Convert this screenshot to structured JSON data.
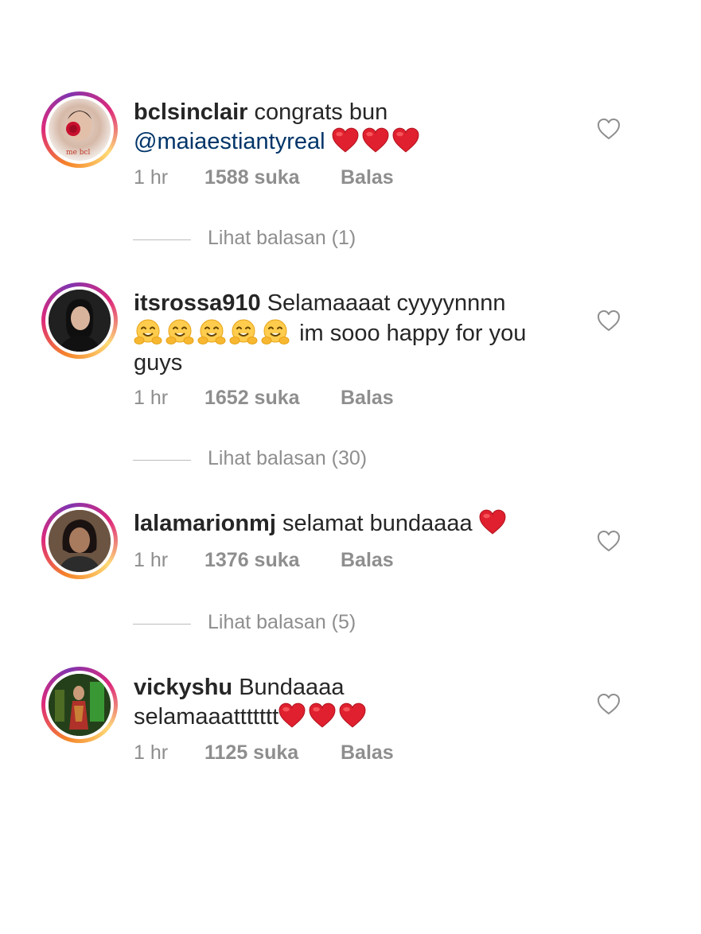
{
  "comments": [
    {
      "username": "bclsinclair",
      "text": "congrats bun",
      "mention": "@maiaestiantyreal",
      "time": "1 hr",
      "likes": "1588 suka",
      "reply": "Balas",
      "view_replies": "Lihat balasan (1)"
    },
    {
      "username": "itsrossa910",
      "text": "Selamaaaat cyyyynnnn",
      "text_after_emoji": "im sooo happy for you guys",
      "time": "1 hr",
      "likes": "1652 suka",
      "reply": "Balas",
      "view_replies": "Lihat balasan (30)"
    },
    {
      "username": "lalamarionmj",
      "text": "selamat bundaaaa",
      "time": "1 hr",
      "likes": "1376 suka",
      "reply": "Balas",
      "view_replies": "Lihat balasan (5)"
    },
    {
      "username": "vickyshu",
      "text": "Bundaaaa selamaaattttttt",
      "time": "1 hr",
      "likes": "1125 suka",
      "reply": "Balas"
    }
  ],
  "colors": {
    "text": "#262626",
    "secondary": "#8e8e8e",
    "mention": "#003569",
    "heart_emoji": "#e0202f",
    "ring_gradient": [
      "#f58529",
      "#dd2a7b",
      "#8134af",
      "#feda77"
    ]
  },
  "icons": {
    "like": "heart-outline-icon",
    "emoji_heart": "red-heart-emoji",
    "emoji_hug": "hugging-face-emoji"
  }
}
